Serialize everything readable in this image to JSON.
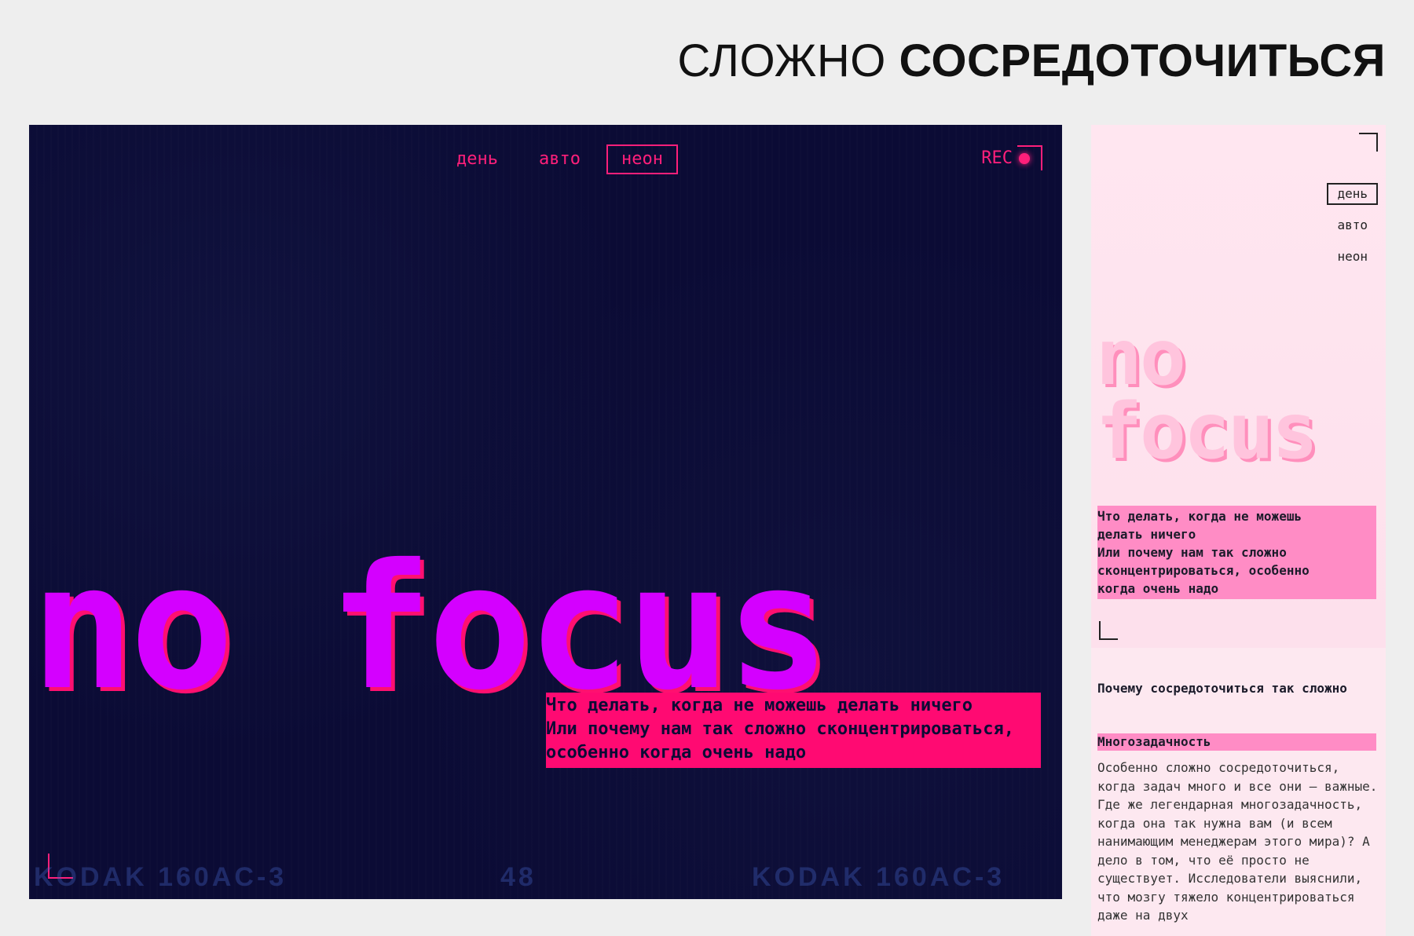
{
  "heading": {
    "light": "СЛОЖНО",
    "bold": "СОСРЕДОТОЧИТЬСЯ"
  },
  "desktop": {
    "modes": [
      "день",
      "авто",
      "неон"
    ],
    "active_mode": "неон",
    "rec_label": "REC",
    "title": "no focus",
    "callout": [
      "Что делать, когда не можешь делать ничего",
      "Или почему нам так сложно сконцентрироваться,",
      "особенно когда очень надо"
    ],
    "film_marks": [
      "KODAK 160AC-3",
      "48",
      "KODAK 160AC-3"
    ]
  },
  "mobile": {
    "modes": [
      "день",
      "авто",
      "неон"
    ],
    "active_mode": "день",
    "title_line1": "no",
    "title_line2": "focus",
    "callout": [
      "Что делать, когда не можешь",
      "делать ничего",
      "Или почему нам так сложно",
      "сконцентрироваться, особенно",
      "когда очень надо"
    ],
    "section_title": "Почему сосредоточиться так сложно",
    "subhead": "Многозадачность",
    "body": "Особенно сложно сосредоточиться, когда задач много и все они — важные. Где же легендарная многозадачность, когда она так нужна вам (и всем нанимающим менеджерам этого мира)? А дело в том, что её просто не существует. Исследователи выяснили, что мозгу тяжело концентрироваться даже на двух"
  },
  "colors": {
    "neon_bg": "#0b0b35",
    "neon_pink": "#ff1f7a",
    "neon_purple": "#d400ff",
    "day_bg": "#fde8f0",
    "day_pink": "#ff8cc5"
  }
}
